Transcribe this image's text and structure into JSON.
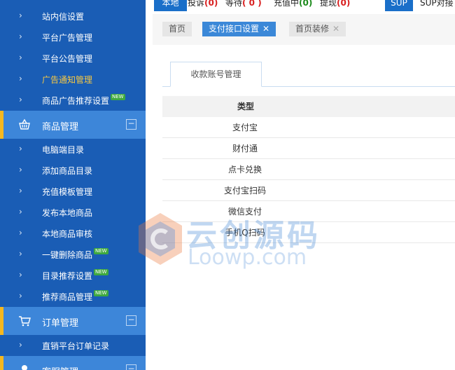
{
  "sidebar": {
    "items_top": [
      {
        "label": "站内信设置",
        "active": false,
        "new": false
      },
      {
        "label": "平台广告管理",
        "active": false,
        "new": false
      },
      {
        "label": "平台公告管理",
        "active": false,
        "new": false
      },
      {
        "label": "广告通知管理",
        "active": true,
        "new": false
      },
      {
        "label": "商品广告推荐设置",
        "active": false,
        "new": true
      }
    ],
    "group_goods": {
      "label": "商品管理",
      "icon": "basket-icon",
      "collapse": "−"
    },
    "items_goods": [
      {
        "label": "电脑端目录",
        "new": false
      },
      {
        "label": "添加商品目录",
        "new": false
      },
      {
        "label": "充值模板管理",
        "new": false
      },
      {
        "label": "发布本地商品",
        "new": false
      },
      {
        "label": "本地商品审核",
        "new": false
      },
      {
        "label": "一键删除商品",
        "new": true
      },
      {
        "label": "目录推荐设置",
        "new": true
      },
      {
        "label": "推荐商品管理",
        "new": true
      }
    ],
    "group_orders": {
      "label": "订单管理",
      "icon": "cart-icon",
      "collapse": "−"
    },
    "items_orders": [
      {
        "label": "直销平台订单记录",
        "new": false
      }
    ],
    "group_service": {
      "label": "客服管理",
      "icon": "user-icon",
      "collapse": "−"
    },
    "new_badge": "NEW",
    "arrow": "›"
  },
  "topbar": {
    "local": "本地",
    "complaint_label": "投诉",
    "complaint_count": "(0)",
    "waiting_label": "等待",
    "waiting_count": "( 0 )",
    "recharging_label": "充值中",
    "recharging_count": "(0)",
    "withdraw_label": "提现",
    "withdraw_count": "(0)",
    "sup": "SUP",
    "sup_dock": "SUP对接"
  },
  "tabs": [
    {
      "label": "首页",
      "closable": false,
      "active": false
    },
    {
      "label": "支付接口设置",
      "closable": true,
      "active": true
    },
    {
      "label": "首页装修",
      "closable": true,
      "active": false
    }
  ],
  "close_glyph": "✕",
  "content": {
    "subtab": "收款账号管理",
    "table": {
      "header": "类型",
      "rows": [
        "支付宝",
        "财付通",
        "点卡兑换",
        "支付宝扫码",
        "微信支付",
        "手机Q扫码"
      ]
    }
  },
  "watermark": {
    "cn": "云创源码",
    "en": "Loowp.com"
  },
  "colors": {
    "sidebar_bg": "#1a5db5",
    "group_bg": "#3d86d9",
    "accent": "#f5b820",
    "active_text": "#f7c842",
    "tab_active": "#3b88d8"
  }
}
